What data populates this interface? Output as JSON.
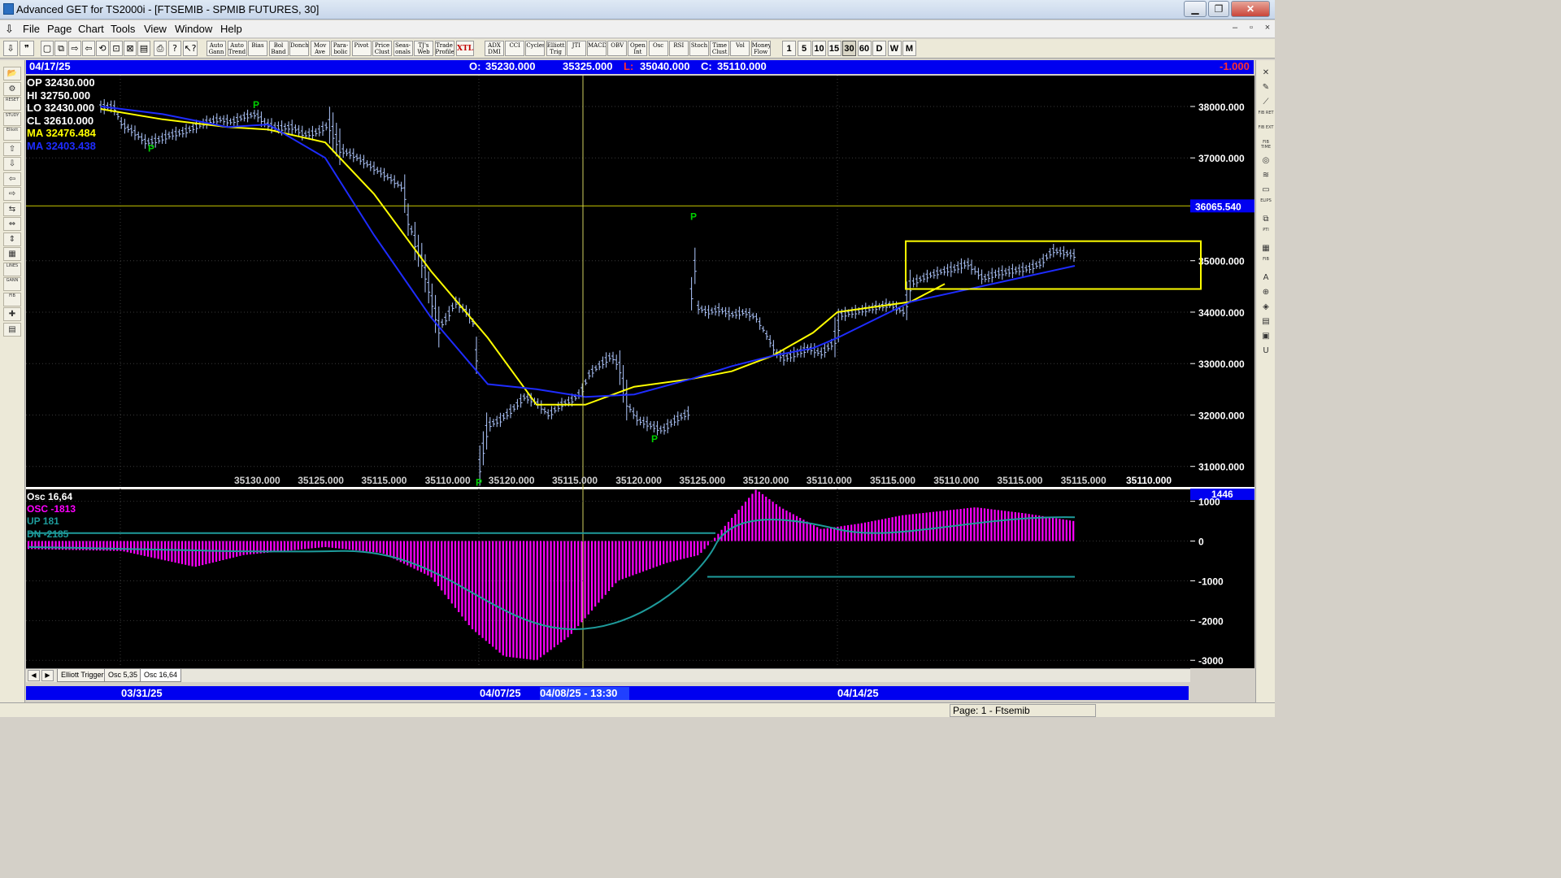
{
  "window": {
    "title": "Advanced GET for TS2000i - [FTSEMIB - SPMIB FUTURES, 30]",
    "buttons": {
      "minimize": "▁",
      "restore": "❐",
      "close": "✕"
    },
    "mdi": {
      "minimize": "–",
      "restore": "▫",
      "close": "×"
    }
  },
  "menu": {
    "file": "File",
    "page": "Page",
    "chart": "Chart",
    "tools": "Tools",
    "view": "View",
    "window": "Window",
    "help": "Help"
  },
  "toolbar": {
    "studies": [
      "Auto Gann",
      "Auto Trend",
      "Bias",
      "Bol Band",
      "Donch",
      "Mov Ave",
      "Para-bolic",
      "Pivot",
      "Price Clust",
      "Seas-onals",
      "TJ's Web",
      "Trade Profile"
    ],
    "xtl": "XTL",
    "indicators": [
      "ADX DMI",
      "CCI",
      "Cycles",
      "Elliott Trig",
      "JTI",
      "MACD",
      "OBV",
      "Open Int",
      "Osc",
      "RSI",
      "Stoch",
      "Time Clust",
      "Vol",
      "Money Flow"
    ],
    "timeframes": [
      "1",
      "5",
      "10",
      "15",
      "30",
      "60",
      "D",
      "W",
      "M"
    ],
    "active_timeframe": "30"
  },
  "left_tools": [
    "📂",
    "⚙",
    "RESET",
    "STUDY",
    "Elliott",
    "⇧",
    "⇩",
    "⇦",
    "⇨",
    "⇆",
    "⇔",
    "⇕",
    "▦",
    "LINES",
    "GANN",
    "FIB",
    "✚",
    "▤"
  ],
  "right_tools": [
    "✕",
    "✎",
    "⟋",
    "FIB RET",
    "FIB EXT",
    "FIB TIME",
    "◎",
    "≋",
    "▭",
    "ELIPS",
    "⧉",
    "PTI",
    "▦",
    "FIB",
    "A",
    "⊕",
    "◈",
    "▤",
    "▣",
    "U"
  ],
  "info_bar": {
    "date": "04/17/25",
    "open_label": "O:",
    "open": "35230.000",
    "high": "35325.000",
    "low_label": "L:",
    "low": "35040.000",
    "close_label": "C:",
    "close": "35110.000",
    "change": "-1.000"
  },
  "legend": [
    {
      "label": "OP",
      "value": "32430.000",
      "color": "#ffffff"
    },
    {
      "label": "HI",
      "value": "32750.000",
      "color": "#ffffff"
    },
    {
      "label": "LO",
      "value": "32430.000",
      "color": "#ffffff"
    },
    {
      "label": "CL",
      "value": "32610.000",
      "color": "#ffffff"
    },
    {
      "label": "MA",
      "value": "32476.484",
      "color": "#ffff00"
    },
    {
      "label": "MA",
      "value": "32403.438",
      "color": "#1e2cff"
    }
  ],
  "price_axis": {
    "ticks": [
      "38000.000",
      "37000.000",
      "35000.000",
      "34000.000",
      "33000.000",
      "32000.000",
      "31000.000"
    ],
    "marker": "36065.540"
  },
  "bottom_prices": [
    "35130.000",
    "35125.000",
    "35115.000",
    "35110.000",
    "35120.000",
    "35115.000",
    "35120.000",
    "35125.000",
    "35120.000",
    "35110.000",
    "35115.000",
    "35110.000",
    "35115.000",
    "35115.000"
  ],
  "bottom_last": "35110.000",
  "pivot_label": "P",
  "osc_legend": {
    "title": "Osc 16,64",
    "osc": "OSC -1813",
    "up": "UP   181",
    "dn": "DN   -2185"
  },
  "osc_axis": {
    "ticks": [
      "1000",
      "0",
      "-1000",
      "-2000",
      "-3000"
    ],
    "marker": "1446"
  },
  "tabs": {
    "left": "◀",
    "right": "▶",
    "items": [
      "Elliott Trigger",
      "Osc 5,35",
      "Osc 16,64"
    ],
    "active": "Osc 16,64"
  },
  "time_axis": {
    "labels": [
      "03/31/25",
      "04/07/25",
      "04/14/25"
    ],
    "cursor": "04/08/25 - 13:30"
  },
  "status": {
    "page": "Page: 1 - Ftsemib"
  },
  "colors": {
    "chart_bg": "#000000",
    "ma_fast": "#ffff00",
    "ma_slow": "#1e2cff",
    "osc_bars": "#ff00ff",
    "osc_lines": "#1e9b9b",
    "pivot": "#00d000",
    "bars": "#b0c8ff",
    "header_blue": "#0000f0"
  },
  "chart_data": {
    "type": "line",
    "price_range": [
      30600,
      38600
    ],
    "series": [
      {
        "name": "MA",
        "values": [
          37950,
          37750,
          37600,
          37550,
          37300,
          36300,
          34800,
          33500,
          32200,
          32200,
          32550,
          32700,
          32850,
          33150,
          33600,
          34000,
          34200,
          34550
        ]
      },
      {
        "name": "MA",
        "values": [
          38000,
          37850,
          37600,
          37650,
          37000,
          35500,
          33900,
          32600,
          32500,
          32350,
          32400,
          32700,
          32950,
          33150,
          33300,
          33500,
          34200,
          34900
        ]
      }
    ],
    "oscillator": {
      "range": [
        -3200,
        1300
      ]
    }
  }
}
